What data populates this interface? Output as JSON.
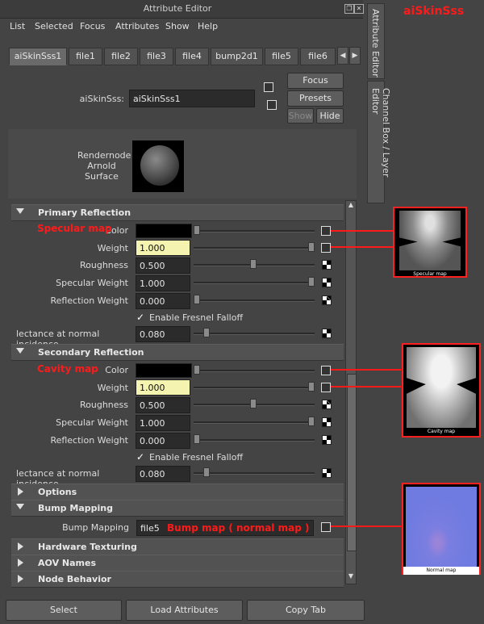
{
  "window": {
    "title": "Attribute Editor"
  },
  "menu": [
    "List",
    "Selected",
    "Focus",
    "Attributes",
    "Show",
    "Help"
  ],
  "tabs": [
    "aiSkinSss1",
    "file1",
    "file2",
    "file3",
    "file4",
    "bump2d1",
    "file5",
    "file6"
  ],
  "node": {
    "type_label": "aiSkinSss:",
    "name_value": "aiSkinSss1",
    "focus": "Focus",
    "presets": "Presets",
    "show": "Show",
    "hide": "Hide",
    "swatch_label_1": "Rendernode",
    "swatch_label_2": "Arnold",
    "swatch_label_3": "Surface"
  },
  "primary": {
    "title": "Primary Reflection",
    "color_label": "Color",
    "weight_label": "Weight",
    "weight_value": "1.000",
    "roughness_label": "Roughness",
    "roughness_value": "0.500",
    "spec_weight_label": "Specular Weight",
    "spec_weight_value": "1.000",
    "refl_weight_label": "Reflection Weight",
    "refl_weight_value": "0.000",
    "fresnel_label": "Enable Fresnel Falloff",
    "normal_label": "lectance at normal incidence",
    "normal_value": "0.080"
  },
  "secondary": {
    "title": "Secondary Reflection",
    "color_label": "Color",
    "weight_label": "Weight",
    "weight_value": "1.000",
    "roughness_label": "Roughness",
    "roughness_value": "0.500",
    "spec_weight_label": "Specular Weight",
    "spec_weight_value": "1.000",
    "refl_weight_label": "Reflection Weight",
    "refl_weight_value": "0.000",
    "fresnel_label": "Enable Fresnel Falloff",
    "normal_label": "lectance at normal incidence",
    "normal_value": "0.080"
  },
  "sections": {
    "options": "Options",
    "bump": "Bump Mapping",
    "hardware": "Hardware Texturing",
    "aov": "AOV Names",
    "behavior": "Node Behavior"
  },
  "bump": {
    "label": "Bump Mapping",
    "value": "file5"
  },
  "bottom": {
    "select": "Select",
    "load": "Load Attributes",
    "copy": "Copy Tab"
  },
  "side_tabs": {
    "attribute": "Attribute Editor",
    "channel": "Channel Box / Layer Editor"
  },
  "annotations": {
    "title": "aiSkinSss",
    "specular": "Specular map",
    "cavity": "Cavity map",
    "bump": "Bump map ( normal map )",
    "thumb_specular": "Specular map",
    "thumb_cavity": "Cavity map",
    "thumb_normal": "Normal map"
  },
  "colors": {
    "annotation": "#ff1a1a",
    "highlight_field": "#f4f4b0"
  }
}
